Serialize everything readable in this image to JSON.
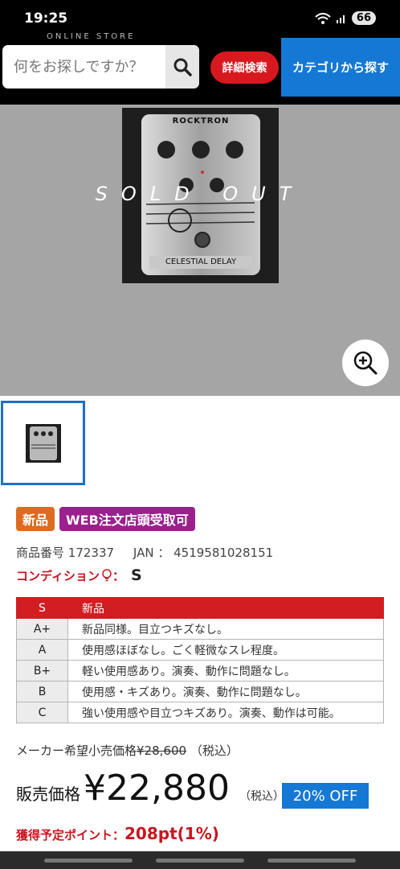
{
  "status_bar": {
    "time": "19:25",
    "battery": "66"
  },
  "header": {
    "store_label": "ONLINE STORE",
    "search_placeholder": "何をお探しですか？",
    "detail_search_label": "詳細検索",
    "category_label": "カテゴリから探す"
  },
  "hero": {
    "overlay_text": "SOLD OUT",
    "pedal_brand": "ROCKTRON",
    "pedal_name": "CELESTIAL DELAY"
  },
  "product": {
    "badges": [
      {
        "label": "新品"
      },
      {
        "label": "WEB注文店頭受取可"
      }
    ],
    "item_no_label": "商品番号",
    "item_no": "172337",
    "jan_label": "JAN ：",
    "jan": "4519581028151",
    "condition_label": "コンディション",
    "condition_sep": "：",
    "condition_value": "S"
  },
  "grade_table": [
    {
      "grade": "S",
      "desc": "新品"
    },
    {
      "grade": "A+",
      "desc": "新品同様。目立つキズなし。"
    },
    {
      "grade": "A",
      "desc": "使用感ほぼなし。ごく軽微なスレ程度。"
    },
    {
      "grade": "B+",
      "desc": "軽い使用感あり。演奏、動作に問題なし。"
    },
    {
      "grade": "B",
      "desc": "使用感・キズあり。演奏、動作に問題なし。"
    },
    {
      "grade": "C",
      "desc": "強い使用感や目立つキズあり。演奏、動作は可能。"
    }
  ],
  "pricing": {
    "maker_label": "メーカー希望小売価格",
    "maker_price": "¥28,600",
    "maker_tax": "（税込）",
    "sale_label": "販売価格",
    "sale_price": "¥22,880",
    "sale_tax": "（税込）",
    "discount": "20% OFF",
    "points_label": "獲得予定ポイント：",
    "points_value": "208pt(1%)"
  }
}
